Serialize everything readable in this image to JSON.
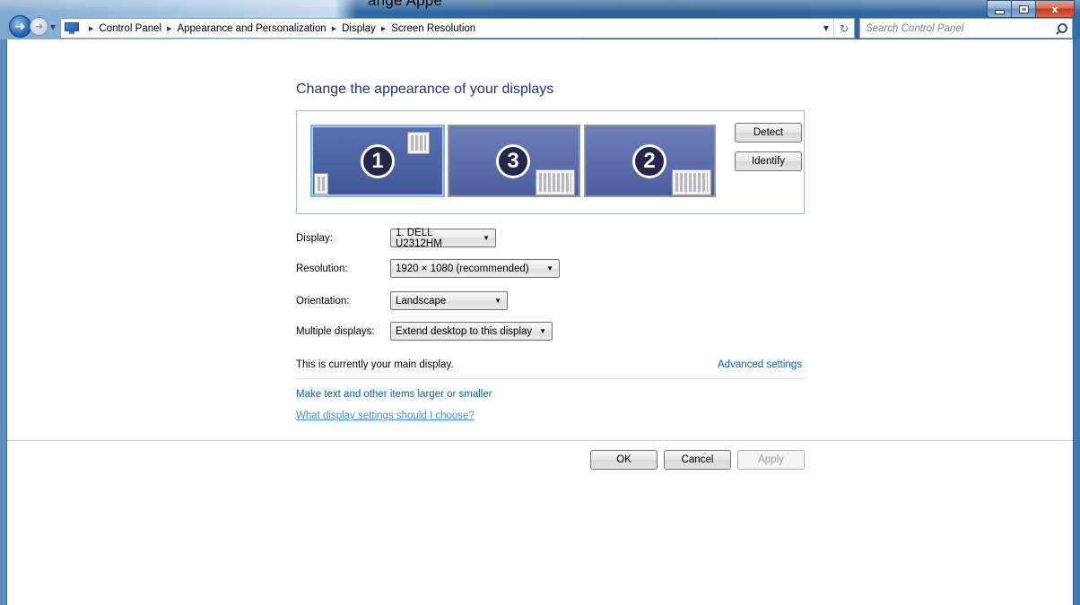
{
  "window": {
    "title_fragment": "ange Appe",
    "caption": {
      "minimize": "—",
      "maximize": "□",
      "close": "x"
    }
  },
  "address_bar": {
    "breadcrumbs": [
      "Control Panel",
      "Appearance and Personalization",
      "Display",
      "Screen Resolution"
    ],
    "refresh_glyph": "↻"
  },
  "search": {
    "placeholder": "Search Control Panel"
  },
  "main": {
    "heading": "Change the appearance of your displays",
    "monitors": [
      {
        "number": "1",
        "selected": true
      },
      {
        "number": "3",
        "selected": false
      },
      {
        "number": "2",
        "selected": false
      }
    ],
    "detect_label": "Detect",
    "identify_label": "Identify",
    "fields": {
      "display": {
        "label": "Display:",
        "value": "1. DELL U2312HM"
      },
      "resolution": {
        "label": "Resolution:",
        "value": "1920 × 1080 (recommended)"
      },
      "orientation": {
        "label": "Orientation:",
        "value": "Landscape"
      },
      "multiple": {
        "label": "Multiple displays:",
        "value": "Extend desktop to this display"
      }
    },
    "main_display_text": "This is currently your main display.",
    "advanced_link": "Advanced settings",
    "larger_link": "Make text and other items larger or smaller",
    "help_link": "What display settings should I choose?"
  },
  "buttons": {
    "ok": "OK",
    "cancel": "Cancel",
    "apply": "Apply"
  },
  "colors": {
    "heading": "#1e3287",
    "link": "#0b5fa8",
    "monitor": "#4d5f9e",
    "title_bar": "#2f6aa3"
  }
}
